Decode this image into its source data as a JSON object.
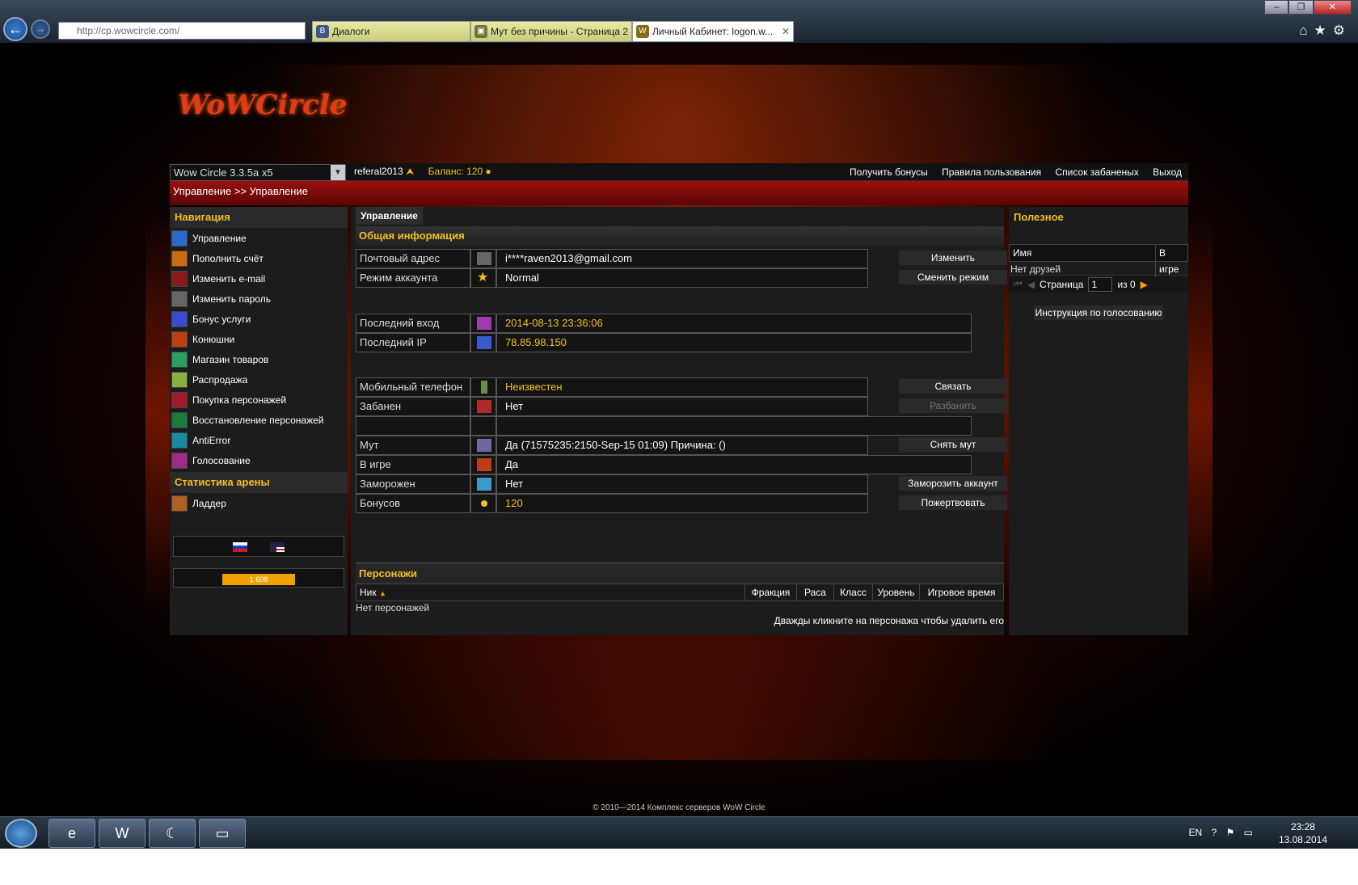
{
  "browser": {
    "url": "http://cp.wowcircle.com/",
    "tabs": [
      {
        "label": "Диалоги",
        "icon": "vk-icon"
      },
      {
        "label": "Мут без причины - Страница 2",
        "icon": "forum-icon"
      },
      {
        "label": "Личный Кабинет: logon.w...",
        "icon": "wow-icon"
      }
    ]
  },
  "header": {
    "logo": "WoWCircle",
    "server": "Wow Circle 3.3.5a x5",
    "username": "referal2013",
    "balance_label": "Баланс:",
    "balance_value": "120",
    "links": [
      "Получить бонусы",
      "Правила пользования",
      "Список забаненых",
      "Выход"
    ],
    "breadcrumb": "Управление >> Управление"
  },
  "nav": {
    "title": "Навигация",
    "items": [
      {
        "label": "Управление",
        "icon": "manage-icon",
        "color": "#2a6ad0"
      },
      {
        "label": "Пополнить счёт",
        "icon": "topup-icon",
        "color": "#d06a10"
      },
      {
        "label": "Изменить e-mail",
        "icon": "email-icon",
        "color": "#8a1a1a"
      },
      {
        "label": "Изменить пароль",
        "icon": "password-icon",
        "color": "#666"
      },
      {
        "label": "Бонус услуги",
        "icon": "bonus-icon",
        "color": "#3a4ad0"
      },
      {
        "label": "Конюшни",
        "icon": "stable-icon",
        "color": "#c04010"
      },
      {
        "label": "Магазин товаров",
        "icon": "shop-icon",
        "color": "#2aa060"
      },
      {
        "label": "Распродажа",
        "icon": "sale-icon",
        "color": "#8ab040"
      },
      {
        "label": "Покупка персонажей",
        "icon": "buy-char-icon",
        "color": "#a01a2a"
      },
      {
        "label": "Восстановление персонажей",
        "icon": "restore-icon",
        "color": "#1a7a3a"
      },
      {
        "label": "AntiError",
        "icon": "antierror-icon",
        "color": "#1a8aa0"
      },
      {
        "label": "Голосование",
        "icon": "vote-icon",
        "color": "#a02a8a"
      }
    ],
    "arena_title": "Статистика арены",
    "arena_items": [
      {
        "label": "Ладдер",
        "icon": "ladder-icon",
        "color": "#b06020"
      }
    ],
    "counter": "1 608"
  },
  "main": {
    "tab": "Управление",
    "section": "Общая информация",
    "rows": {
      "email": {
        "label": "Почтовый адрес",
        "value": "i****raven2013@gmail.com",
        "button": "Изменить"
      },
      "mode": {
        "label": "Режим аккаунта",
        "value": "Normal",
        "button": "Сменить режим"
      },
      "last_login": {
        "label": "Последний вход",
        "value": "2014-08-13 23:36:06"
      },
      "last_ip": {
        "label": "Последний IP",
        "value": "78.85.98.150"
      },
      "phone": {
        "label": "Мобильный телефон",
        "value": "Неизвестен",
        "button": "Связать"
      },
      "banned": {
        "label": "Забанен",
        "value": "Нет",
        "button": "Разбанить"
      },
      "mute": {
        "label": "Мут",
        "value": "Да (71575235:2150-Sep-15 01:09) Причина: ()",
        "button": "Снять мут"
      },
      "ingame": {
        "label": "В игре",
        "value": "Да"
      },
      "frozen": {
        "label": "Заморожен",
        "value": "Нет",
        "button": "Заморозить аккаунт"
      },
      "bonuses": {
        "label": "Бонусов",
        "value": "120",
        "button": "Пожертвовать"
      }
    },
    "characters": {
      "title": "Персонажи",
      "columns": [
        "Ник",
        "Фракция",
        "Раса",
        "Класс",
        "Уровень",
        "Игровое время"
      ],
      "empty": "Нет персонажей",
      "hint": "Дважды кликните на персонажа чтобы удалить его"
    }
  },
  "right": {
    "title": "Полезное",
    "columns": [
      "Имя",
      "В игре"
    ],
    "empty": "Нет друзей",
    "page_label": "Страница",
    "page_value": "1",
    "of_label": "из 0",
    "vote_button": "Инструкция по голосованию"
  },
  "footer": "© 2010—2014 Комплекс серверов WoW Circle",
  "taskbar": {
    "lang": "EN",
    "time": "23:28",
    "date": "13.08.2014"
  }
}
